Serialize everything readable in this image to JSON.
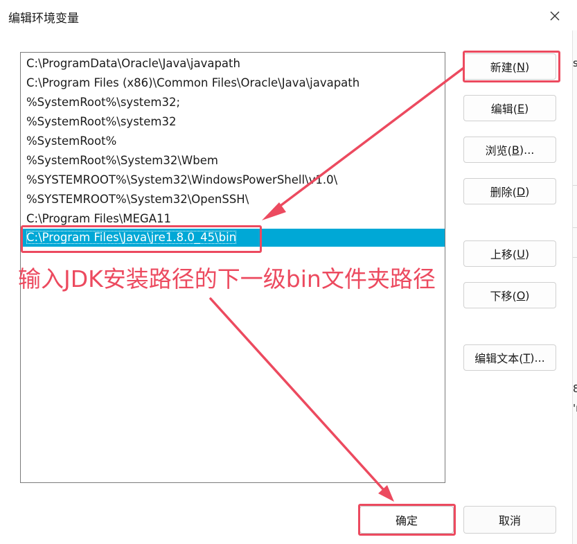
{
  "window": {
    "title": "编辑环境变量",
    "close_glyph": "✕"
  },
  "paths": [
    "C:\\ProgramData\\Oracle\\Java\\javapath",
    "C:\\Program Files (x86)\\Common Files\\Oracle\\Java\\javapath",
    "%SystemRoot%\\system32;",
    "%SystemRoot%\\system32",
    "%SystemRoot%",
    "%SystemRoot%\\System32\\Wbem",
    "%SYSTEMROOT%\\System32\\WindowsPowerShell\\v1.0\\",
    "%SYSTEMROOT%\\System32\\OpenSSH\\",
    "C:\\Program Files\\MEGA11"
  ],
  "selected_path": "C:\\Program Files\\Java\\jre1.8.0_45\\bin",
  "buttons": {
    "new": {
      "label": "新建(",
      "key": "N",
      "end": ")"
    },
    "edit": {
      "label": "编辑(",
      "key": "E",
      "end": ")"
    },
    "browse": {
      "label": "浏览(",
      "key": "B",
      "end": ")..."
    },
    "delete": {
      "label": "删除(",
      "key": "D",
      "end": ")"
    },
    "move_up": {
      "label": "上移(",
      "key": "U",
      "end": ")"
    },
    "move_down": {
      "label": "下移(",
      "key": "O",
      "end": ")"
    },
    "edit_text": {
      "label": "编辑文本(",
      "key": "T",
      "end": ")..."
    },
    "ok": "确定",
    "cancel": "取消"
  },
  "annotation": {
    "text": "输入JDK安装路径的下一级bin文件夹路径",
    "color": "#ec4a5f"
  },
  "background_window_fragments": {
    "top_char": "s",
    "mid_char_1": "8",
    "mid_char_2": "'r"
  },
  "colors": {
    "selection": "#00a8d6",
    "annotation": "#ec4a5f"
  }
}
